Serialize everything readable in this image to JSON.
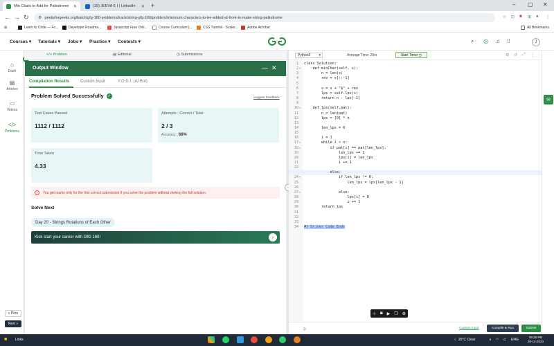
{
  "browser": {
    "tabs": [
      {
        "label": "Min Chars to Add for Palindrome",
        "active": true
      },
      {
        "label": "(19) JEEVA E I | LinkedIn",
        "active": false
      }
    ],
    "url": "geeksforgeeks.org/batch/gfg-160-problems/track/string-gfg-160/problem/minimum-characters-to-be-added-at-front-to-make-string-palindrome",
    "bookmarks": [
      "Learn to Code — Fo...",
      "Developer Roadma...",
      "Javascript Free Onli...",
      "Course Curriculum |...",
      "CSS Tutorial - Scaler...",
      "Adobe Acrobat"
    ],
    "all_bookmarks": "All Bookmarks"
  },
  "nav": {
    "menu": [
      "Courses",
      "Tutorials",
      "Jobs",
      "Practice",
      "Contests"
    ],
    "logo_text": "GfG",
    "avatar_letter": "J"
  },
  "sidebar": {
    "items": [
      "Dash",
      "Articles",
      "Videos",
      "Problems"
    ],
    "prev": "« Prev",
    "next": "Next »"
  },
  "problem_tabs": [
    "Problem",
    "Editorial",
    "Submissions"
  ],
  "output": {
    "title": "Output Window",
    "tabs": [
      "Compilation Results",
      "Custom Input",
      "Y.O.G.I. (AI Bot)"
    ],
    "status": "Problem Solved Successfully",
    "feedback": "Suggest Feedback",
    "tests_label": "Test Cases Passed",
    "tests_value": "1112 / 1112",
    "attempts_label": "Attempts : Correct / Total",
    "attempts_value": "2 / 3",
    "accuracy_label": "Accuracy :",
    "accuracy_value": "66%",
    "time_label": "Time Taken",
    "time_value": "4.33",
    "notice": "You get marks only for the first correct submission if you solve the problem without viewing the full solution.",
    "solve_next": "Solve Next",
    "next_problem": "Day 20 - Strings Rotations of Each Other",
    "kickstart": "Kick start your career with GfG 160!"
  },
  "editor": {
    "language": "Python3",
    "avg_time": "Average Time: 25m",
    "start_timer": "Start Timer",
    "lines": [
      {
        "n": "1",
        "t": "class Solution:"
      },
      {
        "n": "2",
        "t": "    def minChar(self, s):"
      },
      {
        "n": "3",
        "t": "        n = len(s)"
      },
      {
        "n": "4",
        "t": "        rev = s[::-1]"
      },
      {
        "n": "5",
        "t": ""
      },
      {
        "n": "6",
        "t": "        s = s + \"$\" + rev"
      },
      {
        "n": "7",
        "t": "        lps = self.lps(s)"
      },
      {
        "n": "8",
        "t": "        return n - lps[-1]"
      },
      {
        "n": "9",
        "t": ""
      },
      {
        "n": "10",
        "t": "    def lps(self,pat):"
      },
      {
        "n": "11",
        "t": "        n = len(pat)"
      },
      {
        "n": "12",
        "t": "        lps = [0] * n"
      },
      {
        "n": "13",
        "t": ""
      },
      {
        "n": "14",
        "t": "        len_lps = 0"
      },
      {
        "n": "15",
        "t": ""
      },
      {
        "n": "16",
        "t": "        i = 1"
      },
      {
        "n": "17",
        "t": "        while i < n:"
      },
      {
        "n": "18",
        "t": "            if pat[i] == pat[len_lps]:"
      },
      {
        "n": "19",
        "t": "                len_lps += 1"
      },
      {
        "n": "20",
        "t": "                lps[i] = len_lps"
      },
      {
        "n": "21",
        "t": "                i += 1"
      },
      {
        "n": "22",
        "t": ""
      },
      {
        "n": "23",
        "t": "            else:"
      },
      {
        "n": "24",
        "t": "                if len_lps != 0:"
      },
      {
        "n": "25",
        "t": "                    len_lps = lps[len_lps - 1]"
      },
      {
        "n": "26",
        "t": ""
      },
      {
        "n": "27",
        "t": "                else:"
      },
      {
        "n": "28",
        "t": "                    lps[i] = 0"
      },
      {
        "n": "29",
        "t": "                    i += 1"
      },
      {
        "n": "30",
        "t": "        return lps"
      },
      {
        "n": "31",
        "t": ""
      },
      {
        "n": "32",
        "t": ""
      },
      {
        "n": "33",
        "t": ""
      },
      {
        "n": "34",
        "t": "#} Driver Code Ends"
      }
    ],
    "custom_input": "Custom Input",
    "compile_run": "Compile & Run",
    "submit": "Submit"
  },
  "taskbar": {
    "links": "Links",
    "weather": "25°C  Clear",
    "lang": "ENG",
    "time": "09:35 PM",
    "date": "20-12-2024"
  }
}
